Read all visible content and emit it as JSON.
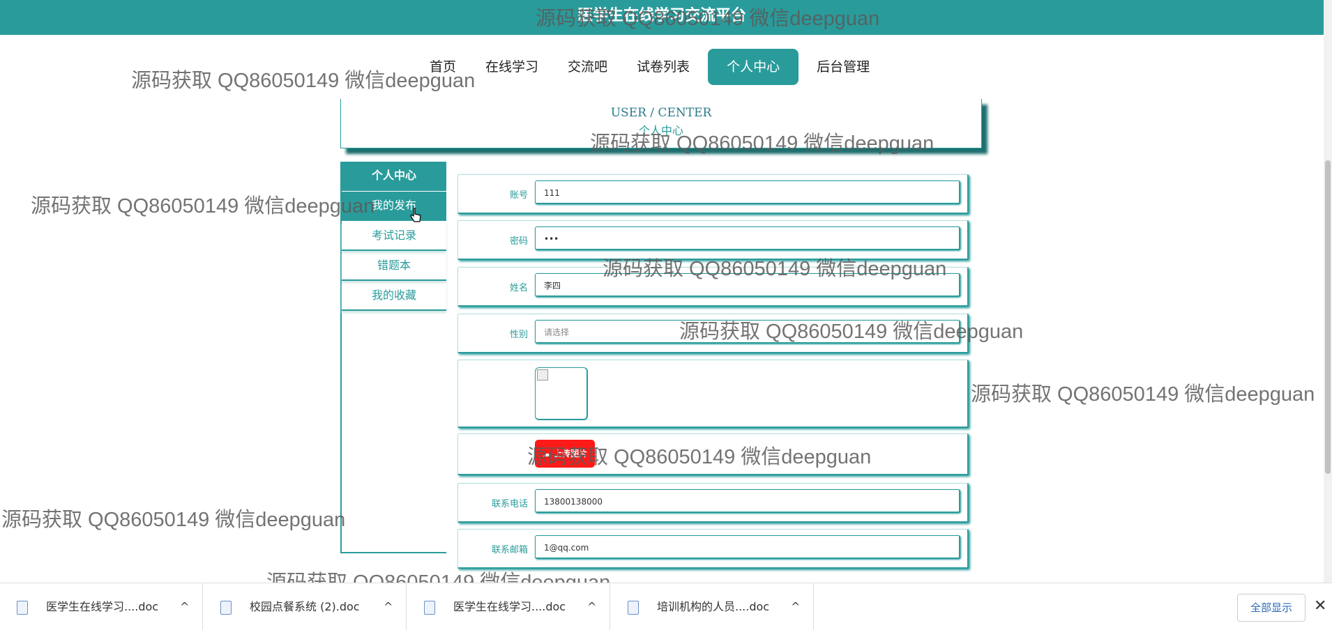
{
  "header": {
    "title": "医学生在线学习交流平台"
  },
  "nav": {
    "items": [
      {
        "label": "首页",
        "active": false
      },
      {
        "label": "在线学习",
        "active": false
      },
      {
        "label": "交流吧",
        "active": false
      },
      {
        "label": "试卷列表",
        "active": false
      },
      {
        "label": "个人中心",
        "active": true
      },
      {
        "label": "后台管理",
        "active": false
      }
    ]
  },
  "center": {
    "en": "USER / CENTER",
    "cn": "个人中心"
  },
  "sidebar": {
    "items": [
      {
        "label": "个人中心"
      },
      {
        "label": "我的发布"
      },
      {
        "label": "考试记录"
      },
      {
        "label": "错题本"
      },
      {
        "label": "我的收藏"
      }
    ]
  },
  "form": {
    "account": {
      "label": "账号",
      "value": "111"
    },
    "password": {
      "label": "密码",
      "value": "•••"
    },
    "name": {
      "label": "姓名",
      "value": "李四"
    },
    "gender": {
      "label": "性别",
      "placeholder": "请选择"
    },
    "upload": {
      "label": "上传图片"
    },
    "phone": {
      "label": "联系电话",
      "value": "13800138000"
    },
    "email": {
      "label": "联系邮箱",
      "value": "1@qq.com"
    }
  },
  "watermark": "源码获取 QQ86050149 微信deepguan",
  "downloads": {
    "items": [
      {
        "name": "医学生在线学习....doc"
      },
      {
        "name": "校园点餐系统 (2).doc"
      },
      {
        "name": "医学生在线学习....doc"
      },
      {
        "name": "培训机构的人员....doc"
      }
    ],
    "show_all": "全部显示",
    "close": "✕"
  },
  "colors": {
    "accent": "#2a9b9b",
    "upload": "#ff1a1a"
  }
}
